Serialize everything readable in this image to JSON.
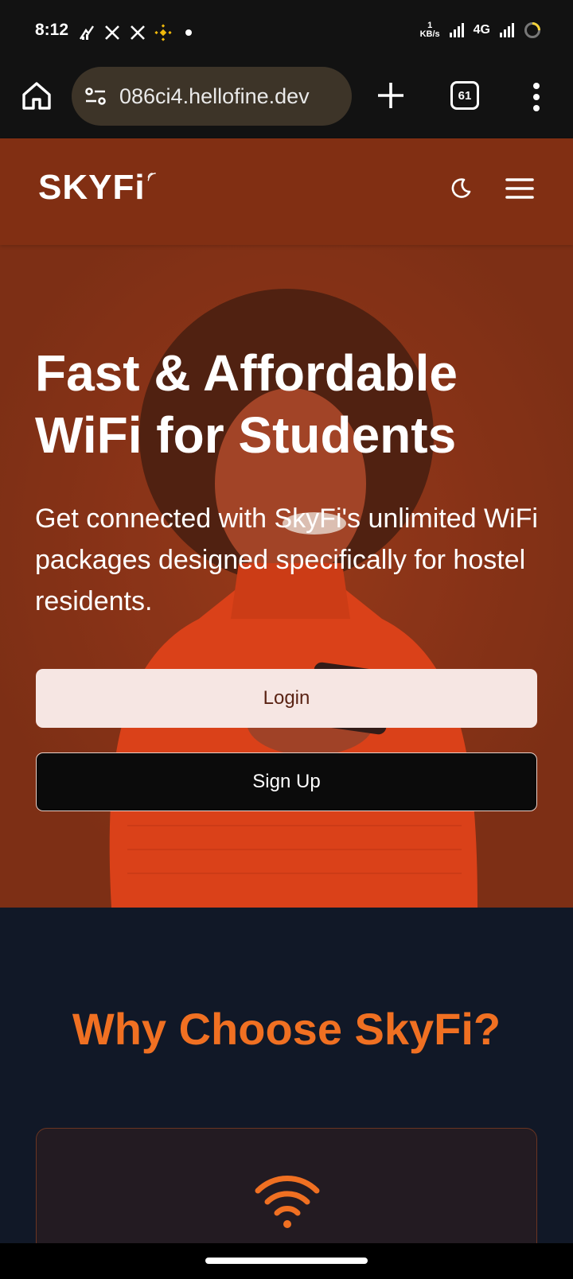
{
  "status_bar": {
    "time": "8:12",
    "left_icons": [
      "network-activity-icon",
      "x-app-icon",
      "x-app-icon",
      "binance-icon",
      "dot-icon"
    ],
    "data_rate_value": "1",
    "data_rate_unit": "KB/s",
    "network_type": "4G",
    "right_icons": [
      "signal-icon",
      "signal-icon",
      "battery-ring-icon"
    ]
  },
  "browser": {
    "url": "086ci4.hellofine.dev",
    "tab_count": "61",
    "icons": [
      "home-icon",
      "site-settings-icon",
      "new-tab-plus-icon",
      "tabs-icon",
      "more-vert-icon"
    ]
  },
  "site_header": {
    "logo_text": "SKYFi",
    "icons": [
      "moon-icon",
      "hamburger-menu-icon"
    ]
  },
  "hero": {
    "title_line1": "Fast & Affordable",
    "title_line2": "WiFi for Students",
    "subtitle": "Get connected with SkyFi's unlimited WiFi packages designed specifically for hostel residents.",
    "login_label": "Login",
    "signup_label": "Sign Up"
  },
  "why_section": {
    "title": "Why Choose SkyFi?",
    "card_icon": "wifi-icon"
  },
  "colors": {
    "header_bg": "#812f13",
    "hero_bg": "#7e2f15",
    "accent_orange": "#f07022",
    "section_bg": "#111827"
  }
}
